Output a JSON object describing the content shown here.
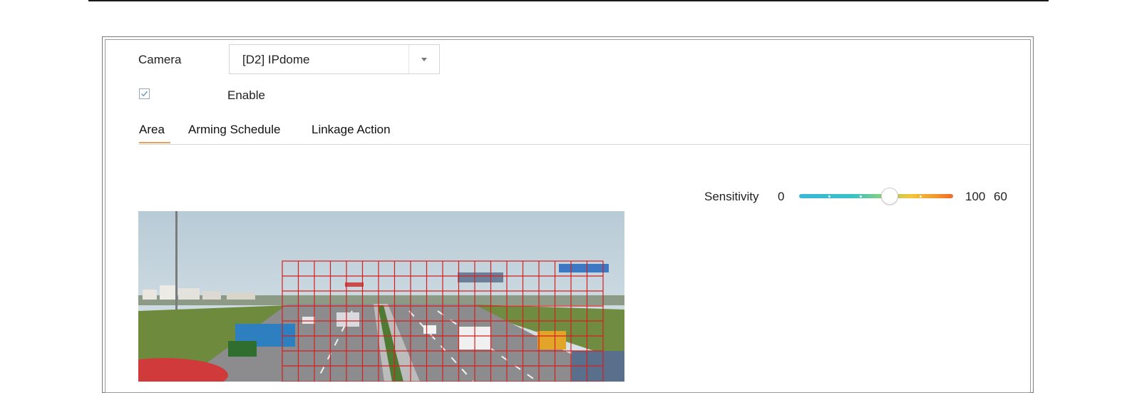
{
  "camera": {
    "label": "Camera",
    "selected": "[D2] IPdome"
  },
  "enable": {
    "label": "Enable",
    "checked": true
  },
  "tabs": [
    {
      "label": "Area",
      "active": true
    },
    {
      "label": "Arming Schedule",
      "active": false
    },
    {
      "label": "Linkage Action",
      "active": false
    }
  ],
  "sensitivity": {
    "label": "Sensitivity",
    "min": "0",
    "max": "100",
    "value": "60"
  },
  "colors": {
    "accent_tab": "#e8a25a",
    "grid": "#d61f1f"
  },
  "icons": {
    "checkbox": "check-icon",
    "dropdown": "chevron-down-icon"
  }
}
